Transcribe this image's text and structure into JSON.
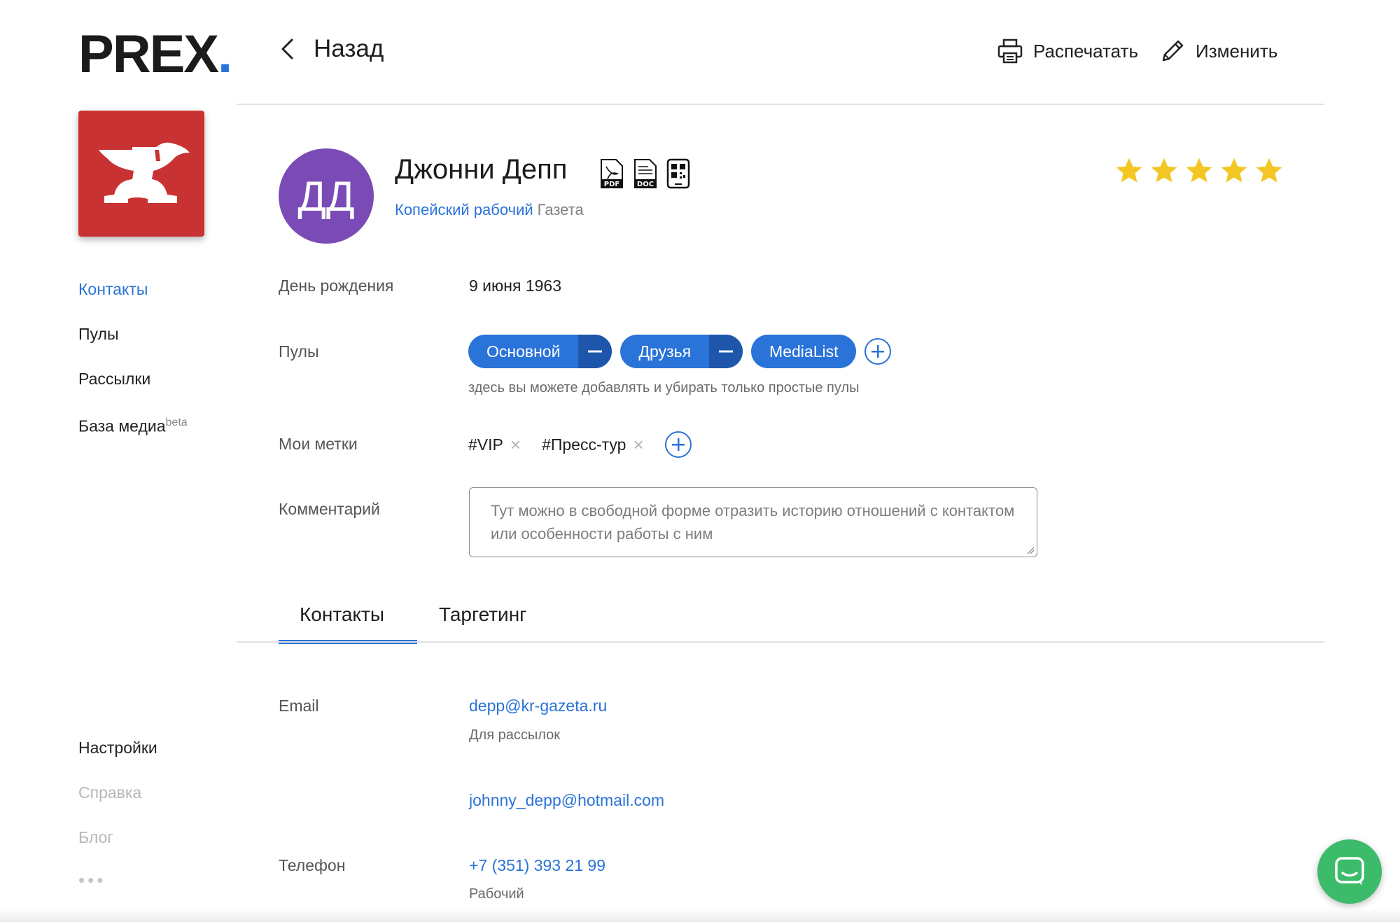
{
  "brand": {
    "logo_text": "PREX",
    "logo_dot": "."
  },
  "sidebar": {
    "items": [
      {
        "label": "Контакты",
        "active": true
      },
      {
        "label": "Пулы"
      },
      {
        "label": "Рассылки"
      },
      {
        "label": "База медиа",
        "badge": "beta"
      }
    ],
    "bottom_items": [
      {
        "label": "Настройки"
      },
      {
        "label": "Справка"
      },
      {
        "label": "Блог"
      }
    ],
    "more_icon": "ellipsis-icon"
  },
  "header": {
    "back_label": "Назад",
    "print_label": "Распечатать",
    "edit_label": "Изменить"
  },
  "profile": {
    "initials": "ДД",
    "name": "Джонни Депп",
    "publication": "Копейский рабочий",
    "publication_type": "Газета",
    "rating": 5,
    "rating_max": 5,
    "export_icons": [
      "pdf-icon",
      "doc-icon",
      "qr-code-icon"
    ]
  },
  "fields": {
    "birthday_label": "День рождения",
    "birthday_value": "9 июня 1963",
    "pools_label": "Пулы",
    "pools": [
      {
        "name": "Основной",
        "removable": true
      },
      {
        "name": "Друзья",
        "removable": true
      },
      {
        "name": "MediaList",
        "removable": false
      }
    ],
    "pools_hint": "здесь вы можете добавлять и убирать только простые пулы",
    "tags_label": "Мои метки",
    "tags": [
      "#VIP",
      "#Пресс-тур"
    ],
    "comment_label": "Комментарий",
    "comment_placeholder": "Тут можно в свободной форме отразить историю отношений с контактом или особенности работы с ним"
  },
  "tabs": [
    {
      "label": "Контакты",
      "active": true
    },
    {
      "label": "Таргетинг",
      "active": false
    }
  ],
  "contacts": {
    "email_label": "Email",
    "emails": [
      {
        "address": "depp@kr-gazeta.ru",
        "note": "Для рассылок"
      },
      {
        "address": "johnny_depp@hotmail.com",
        "note": ""
      }
    ],
    "phone_label": "Телефон",
    "phones": [
      {
        "number": "+7 (351) 393 21 99",
        "note": "Рабочий"
      }
    ]
  },
  "colors": {
    "accent": "#2a73d8",
    "pill_remove": "#1d56aa",
    "app_tile": "#c93232",
    "avatar": "#7a4bb6",
    "star": "#f3c623",
    "chat": "#3cbb6a"
  }
}
